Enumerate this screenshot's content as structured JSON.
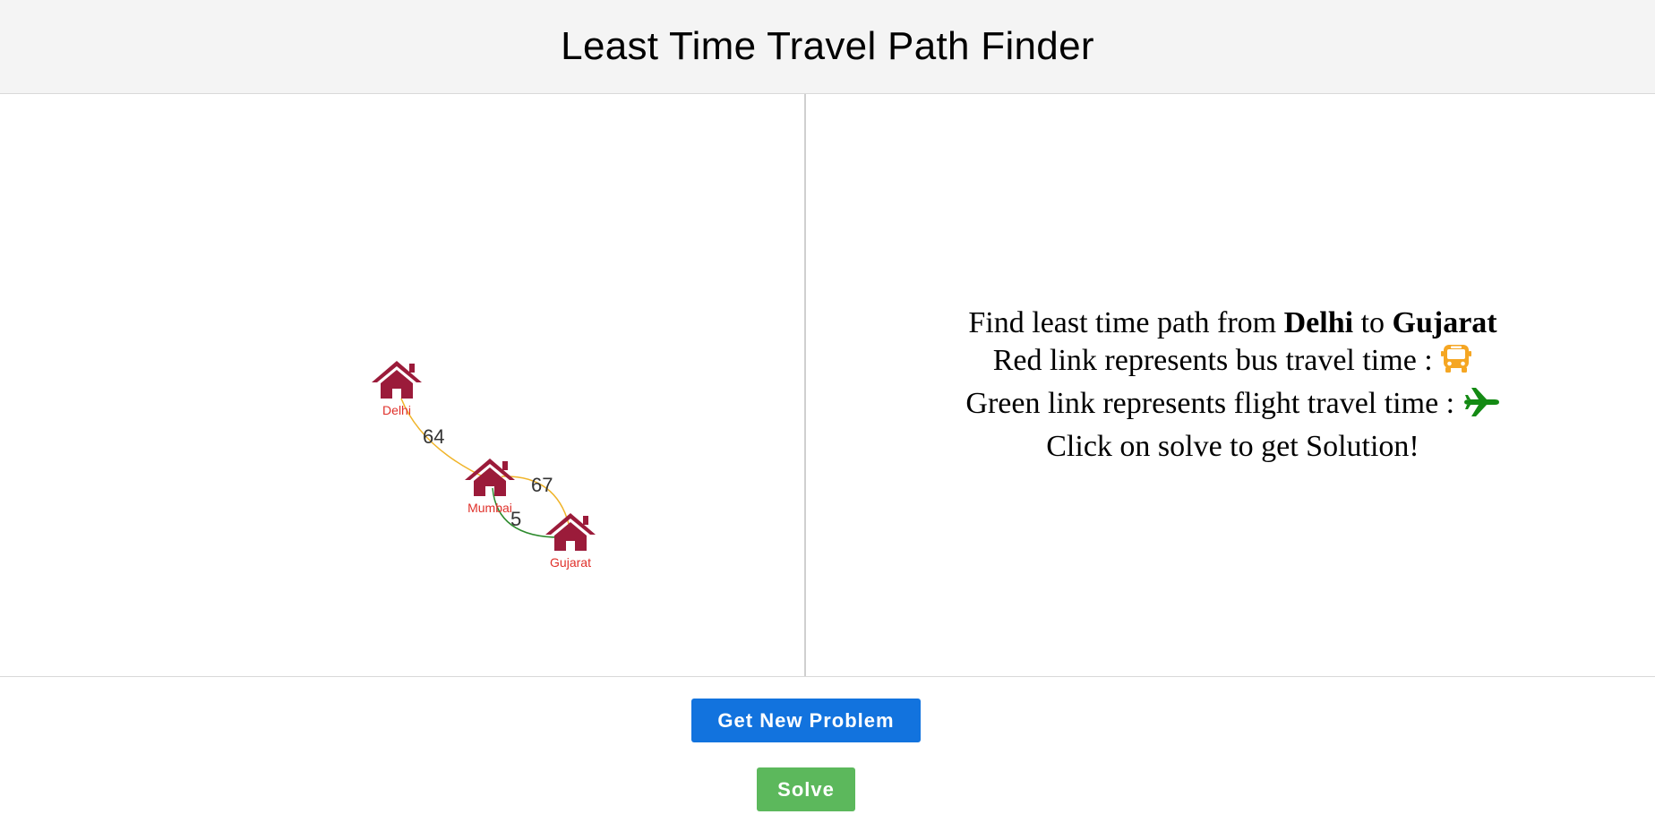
{
  "header": {
    "title": "Least Time Travel Path Finder"
  },
  "graph": {
    "nodes": [
      {
        "id": "delhi",
        "label": "Delhi"
      },
      {
        "id": "mumbai",
        "label": "Mumbai"
      },
      {
        "id": "gujarat",
        "label": "Gujarat"
      }
    ],
    "edges": [
      {
        "from": "delhi",
        "to": "mumbai",
        "weight": "64",
        "type": "bus",
        "color": "#f0b429"
      },
      {
        "from": "mumbai",
        "to": "gujarat",
        "weight": "67",
        "type": "bus",
        "color": "#f0b429"
      },
      {
        "from": "mumbai",
        "to": "gujarat",
        "weight": "5",
        "type": "flight",
        "color": "#2e8b2e"
      }
    ],
    "node_icon": "house-icon",
    "node_color": "#9b1b3a",
    "label_color": "#e0302a"
  },
  "info": {
    "line1_prefix": "Find least time path from ",
    "source": "Delhi",
    "line1_mid": " to ",
    "destination": "Gujarat",
    "line2": "Red link represents bus travel time : ",
    "line2_icon": "bus-icon",
    "line3": "Green link represents flight travel time : ",
    "line3_icon": "plane-icon",
    "line4": "Click on solve to get Solution!"
  },
  "colors": {
    "bus_icon": "#f5a623",
    "plane_icon": "#148a14",
    "new_problem_button": "#1273de",
    "solve_button": "#5cb85c"
  },
  "buttons": {
    "new_problem": "Get New Problem",
    "solve": "Solve"
  }
}
